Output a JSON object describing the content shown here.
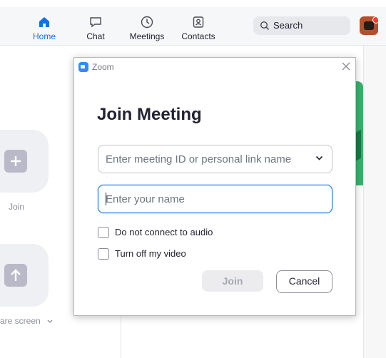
{
  "topnav": {
    "tabs": [
      {
        "label": "Home",
        "icon": "home-icon",
        "active": true
      },
      {
        "label": "Chat",
        "icon": "chat-icon"
      },
      {
        "label": "Meetings",
        "icon": "clock-icon"
      },
      {
        "label": "Contacts",
        "icon": "contacts-icon"
      }
    ],
    "search_label": "Search"
  },
  "home": {
    "join_label": "Join",
    "share_label": "are screen"
  },
  "dialog": {
    "window_title": "Zoom",
    "heading": "Join Meeting",
    "meeting_id_placeholder": "Enter meeting ID or personal link name",
    "name_placeholder": "Enter your name",
    "options": [
      {
        "label": "Do not connect to audio",
        "checked": false
      },
      {
        "label": "Turn off my video",
        "checked": false
      }
    ],
    "join_button": "Join",
    "cancel_button": "Cancel"
  },
  "colors": {
    "accent": "#0e71eb",
    "zoom_blue": "#2d8cff",
    "green_card": "#38b26c"
  }
}
